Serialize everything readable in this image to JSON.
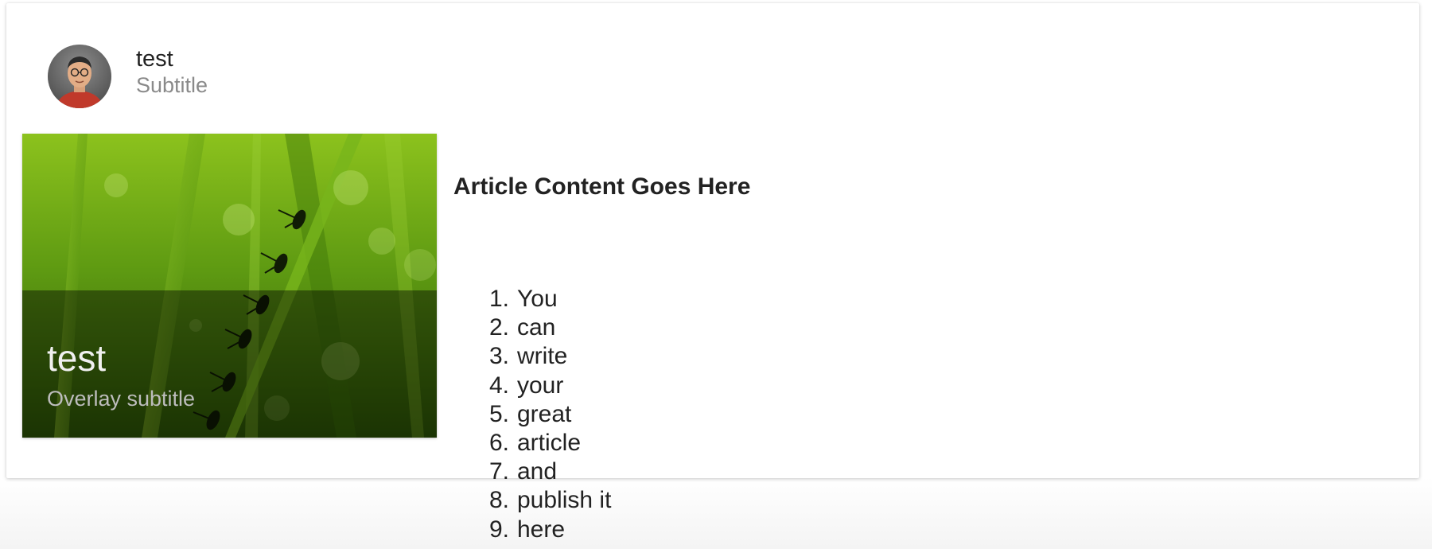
{
  "header": {
    "title": "test",
    "subtitle": "Subtitle"
  },
  "media": {
    "overlay_title": "test",
    "overlay_subtitle": "Overlay subtitle"
  },
  "article": {
    "heading": "Article Content Goes Here",
    "list": [
      {
        "num": "1.",
        "text": "You"
      },
      {
        "num": "2.",
        "text": "can"
      },
      {
        "num": "3.",
        "text": "write"
      },
      {
        "num": "4.",
        "text": "your"
      },
      {
        "num": "5.",
        "text": "great"
      },
      {
        "num": "6.",
        "text": "article"
      },
      {
        "num": "7.",
        "text": "and"
      },
      {
        "num": "8.",
        "text": "publish it"
      },
      {
        "num": "9.",
        "text": "here"
      }
    ]
  },
  "colors": {
    "title_text": "#222222",
    "subtitle_text": "#8a8a8a",
    "overlay_title": "#f0f0f0",
    "overlay_subtitle": "#bdbdbd",
    "grass": "#5a9a12"
  }
}
